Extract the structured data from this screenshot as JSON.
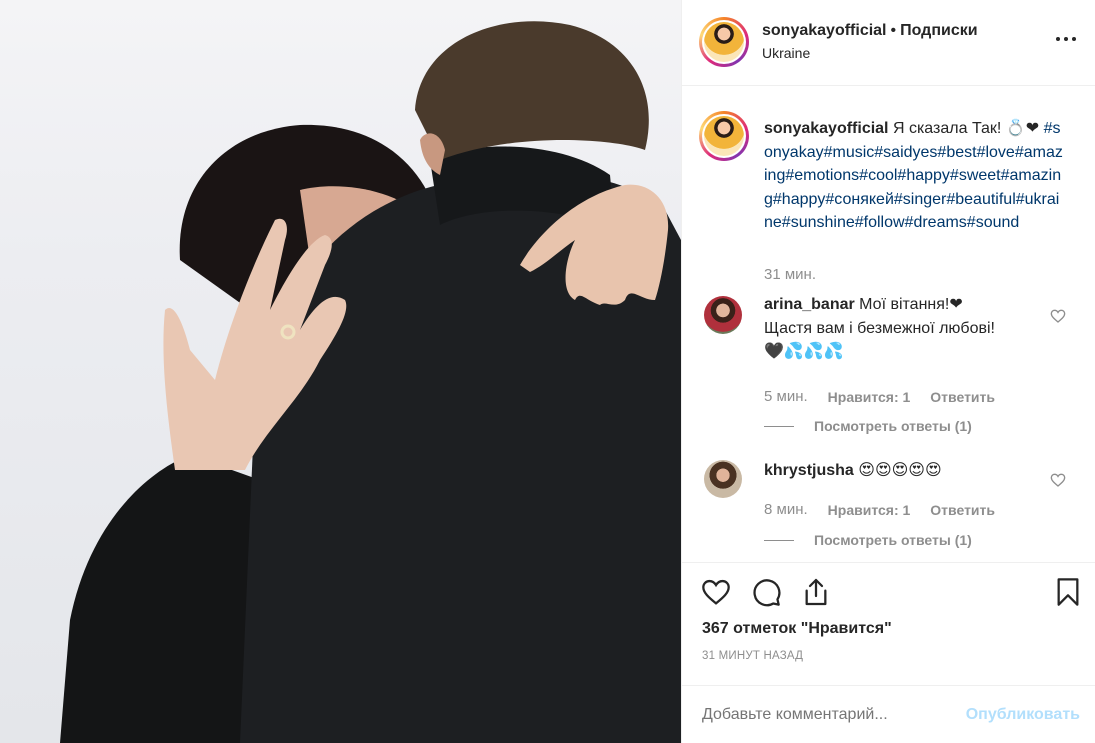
{
  "post": {
    "username": "sonyakayofficial",
    "separator": "•",
    "follow_label": "Подписки",
    "location": "Ukraine"
  },
  "caption": {
    "username": "sonyakayofficial",
    "text": "Я сказала Так! 💍❤",
    "hashtags": "#sonyakay#music#saidyes#best#love#amazing#emotions#cool#happy#sweet#amazing#happy#сонякей#singer#beautiful#ukraine#sunshine#follow#dreams#sound",
    "time": "31 мин."
  },
  "comments": [
    {
      "username": "arina_banar",
      "text_line1": "Мої вітання!❤",
      "text_line2": "Щастя вам і безмежної любові!",
      "text_line3": "🖤💦💦💦",
      "time": "5 мин.",
      "likes": "Нравится: 1",
      "reply": "Ответить",
      "view_replies": "Посмотреть ответы (1)"
    },
    {
      "username": "khrystjusha",
      "text_line1": "😍😍😍😍😍",
      "time": "8 мин.",
      "likes": "Нравится: 1",
      "reply": "Ответить",
      "view_replies": "Посмотреть ответы (1)"
    }
  ],
  "actions": {
    "like_count": "367 отметок \"Нравится\"",
    "posted_ago": "31 МИНУТ НАЗАД"
  },
  "add_comment": {
    "placeholder": "Добавьте комментарий...",
    "publish": "Опубликовать"
  },
  "colors": {
    "hashtag": "#00376b",
    "muted": "#8e8e8e",
    "publish_disabled": "#b2dffc",
    "heart": "#c4161c"
  }
}
